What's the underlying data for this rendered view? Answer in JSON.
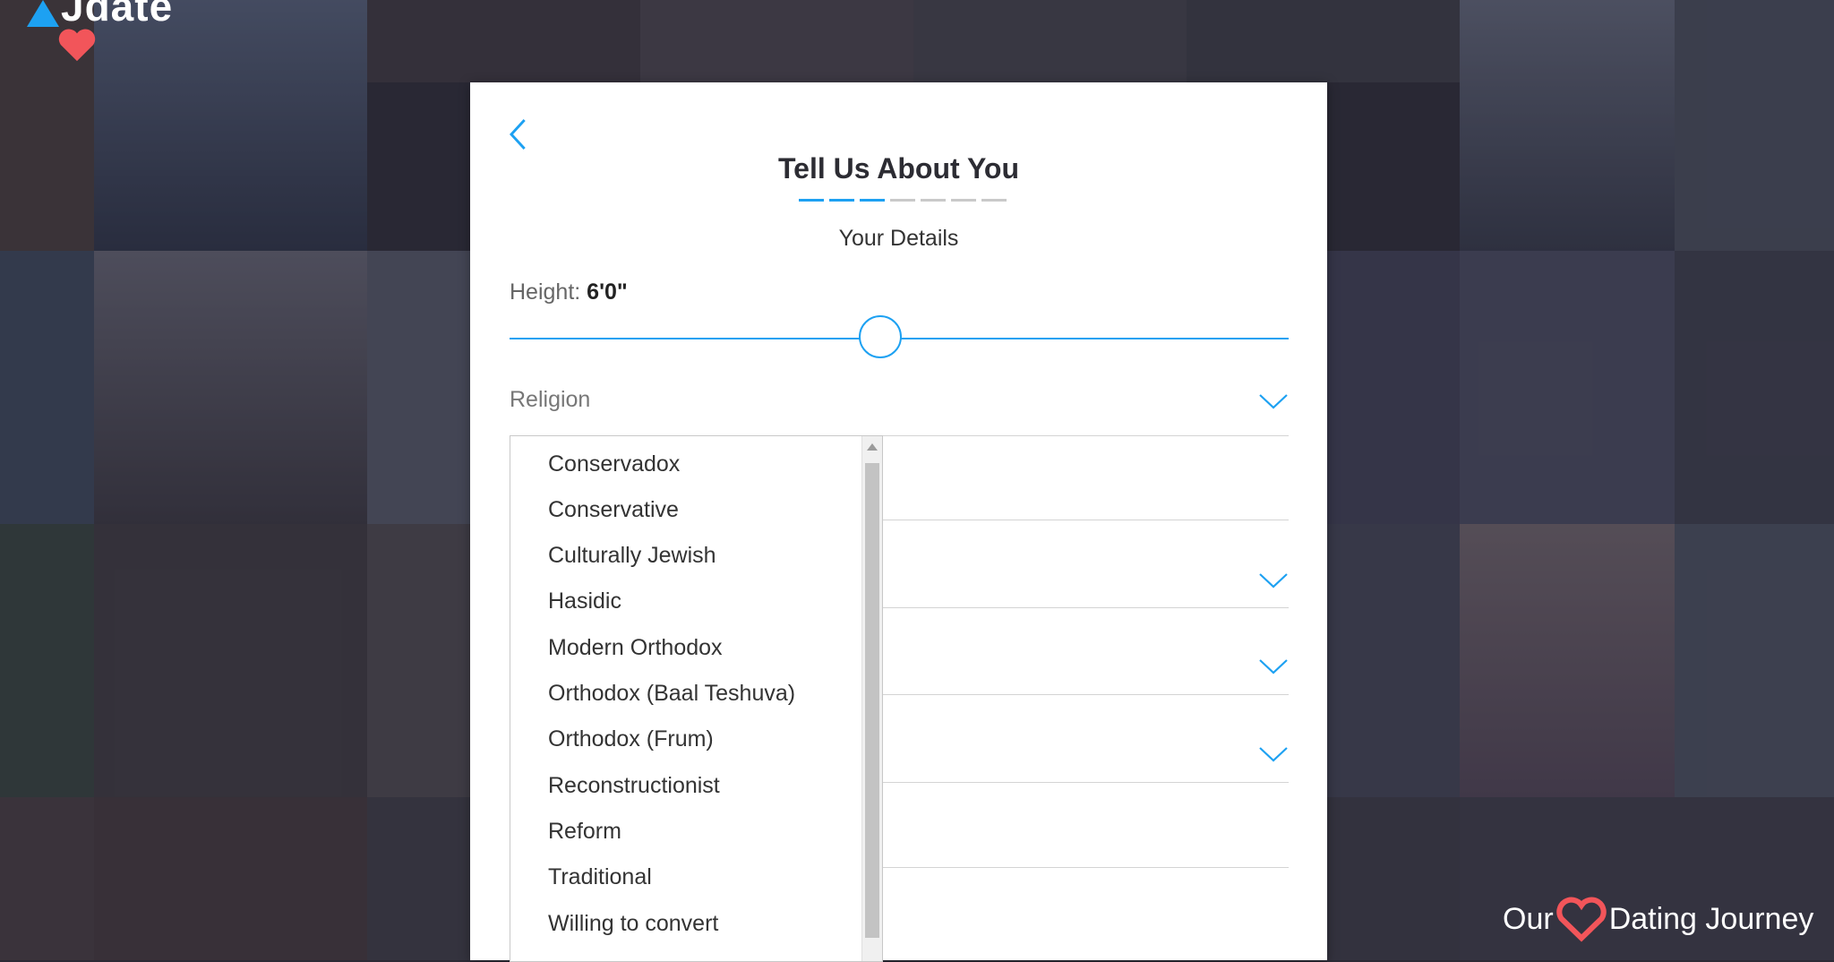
{
  "logo": {
    "text": "Jdate"
  },
  "modal": {
    "title": "Tell Us About You",
    "progress": {
      "total": 7,
      "completed": 3
    },
    "subtitle": "Your Details",
    "height": {
      "label": "Height:",
      "value": "6'0\"",
      "slider_fraction": 0.48
    },
    "religion": {
      "label": "Religion"
    },
    "religion_options": [
      "Conservadox",
      "Conservative",
      "Culturally Jewish",
      "Hasidic",
      "Modern Orthodox",
      "Orthodox (Baal Teshuva)",
      "Orthodox (Frum)",
      "Reconstructionist",
      "Reform",
      "Traditional",
      "Willing to convert"
    ]
  },
  "footer_brand": {
    "left": "Our",
    "right": "Dating Journey"
  },
  "colors": {
    "accent": "#1da1f2",
    "heart": "#f2555a"
  }
}
